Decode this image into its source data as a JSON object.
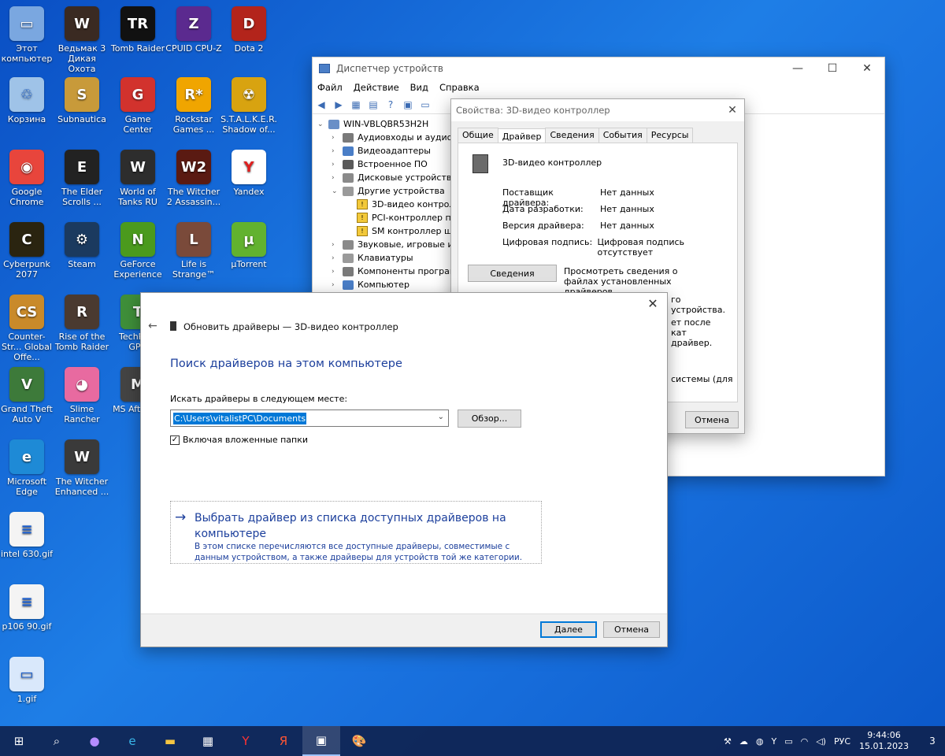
{
  "desktop": {
    "icons": [
      {
        "label": "Этот компьютер",
        "color": "#7aa7e0",
        "glyph": "▭"
      },
      {
        "label": "Ведьмак 3 Дикая Охота",
        "color": "#3a2a22",
        "glyph": "W"
      },
      {
        "label": "Tomb Raider",
        "color": "#111111",
        "glyph": "TR"
      },
      {
        "label": "CPUID CPU-Z",
        "color": "#5b2a8f",
        "glyph": "Z"
      },
      {
        "label": "Dota 2",
        "color": "#b3241b",
        "glyph": "D"
      },
      {
        "label": "Корзина",
        "color": "#9fc3e8",
        "glyph": "♲"
      },
      {
        "label": "Subnautica",
        "color": "#c89a3a",
        "glyph": "S"
      },
      {
        "label": "Game Center",
        "color": "#d2322d",
        "glyph": "G"
      },
      {
        "label": "Rockstar Games ...",
        "color": "#f0a500",
        "glyph": "R*"
      },
      {
        "label": "S.T.A.L.K.E.R. Shadow of...",
        "color": "#d8a310",
        "glyph": "☢"
      },
      {
        "label": "Google Chrome",
        "color": "#e8453c",
        "glyph": "◉"
      },
      {
        "label": "The Elder Scrolls ...",
        "color": "#222222",
        "glyph": "E"
      },
      {
        "label": "World of Tanks RU",
        "color": "#2d2d2d",
        "glyph": "W"
      },
      {
        "label": "The Witcher 2 Assassin...",
        "color": "#5a1a12",
        "glyph": "W2"
      },
      {
        "label": "Yandex",
        "color": "#ffffff",
        "glyph": "Y"
      },
      {
        "label": "Cyberpunk 2077",
        "color": "#2a2410",
        "glyph": "C"
      },
      {
        "label": "Steam",
        "color": "#1b3a5f",
        "glyph": "⚙"
      },
      {
        "label": "GeForce Experience",
        "color": "#4b9a1d",
        "glyph": "N"
      },
      {
        "label": "Life is Strange™",
        "color": "#7a4a3a",
        "glyph": "L"
      },
      {
        "label": "µTorrent",
        "color": "#62b22f",
        "glyph": "µ"
      },
      {
        "label": "Counter-Str... Global Offe...",
        "color": "#c98a2a",
        "glyph": "CS"
      },
      {
        "label": "Rise of the Tomb Raider",
        "color": "#4a3a30",
        "glyph": "R"
      },
      {
        "label": "TechPo... GPU",
        "color": "#3f8f3a",
        "glyph": "T"
      },
      {
        "label": "Grand Theft Auto V",
        "color": "#3d7a3a",
        "glyph": "V"
      },
      {
        "label": "Slime Rancher",
        "color": "#e86aa0",
        "glyph": "◕"
      },
      {
        "label": "MS Afterb...",
        "color": "#444444",
        "glyph": "M"
      },
      {
        "label": "Microsoft Edge",
        "color": "#1e8ad6",
        "glyph": "e"
      },
      {
        "label": "The Witcher Enhanced ...",
        "color": "#3a3a3a",
        "glyph": "W"
      },
      {
        "label": "intel 630.gif",
        "color": "#f4f4f4",
        "glyph": "≡"
      },
      {
        "label": "p106 90.gif",
        "color": "#f4f4f4",
        "glyph": "≡"
      },
      {
        "label": "1.gif",
        "color": "#d9e8fb",
        "glyph": "▭"
      }
    ]
  },
  "device_manager": {
    "title": "Диспетчер устройств",
    "menu": [
      "Файл",
      "Действие",
      "Вид",
      "Справка"
    ],
    "root": "WIN-VBLQBR53H2H",
    "tree": [
      {
        "label": "Аудиовходы и аудиовы",
        "expanded": false,
        "warn": false,
        "indent": 1
      },
      {
        "label": "Видеоадаптеры",
        "expanded": false,
        "warn": false,
        "indent": 1
      },
      {
        "label": "Встроенное ПО",
        "expanded": false,
        "warn": false,
        "indent": 1
      },
      {
        "label": "Дисковые устройства",
        "expanded": false,
        "warn": false,
        "indent": 1
      },
      {
        "label": "Другие устройства",
        "expanded": true,
        "warn": false,
        "indent": 1
      },
      {
        "label": "3D-видео контролл",
        "expanded": false,
        "warn": true,
        "indent": 2
      },
      {
        "label": "PCI-контроллер пам",
        "expanded": false,
        "warn": true,
        "indent": 2
      },
      {
        "label": "SM контроллер ши",
        "expanded": false,
        "warn": true,
        "indent": 2
      },
      {
        "label": "Звуковые, игровые и в",
        "expanded": false,
        "warn": false,
        "indent": 1
      },
      {
        "label": "Клавиатуры",
        "expanded": false,
        "warn": false,
        "indent": 1
      },
      {
        "label": "Компоненты программ",
        "expanded": false,
        "warn": false,
        "indent": 1
      },
      {
        "label": "Компьютер",
        "expanded": false,
        "warn": false,
        "indent": 1
      }
    ]
  },
  "properties": {
    "title": "Свойства: 3D-видео контроллер",
    "tabs": [
      "Общие",
      "Драйвер",
      "Сведения",
      "События",
      "Ресурсы"
    ],
    "active_tab": "Драйвер",
    "device_name": "3D-видео контроллер",
    "rows": [
      {
        "key": "Поставщик драйвера:",
        "value": "Нет данных"
      },
      {
        "key": "Дата разработки:",
        "value": "Нет данных"
      },
      {
        "key": "Версия драйвера:",
        "value": "Нет данных"
      },
      {
        "key": "Цифровая подпись:",
        "value": "Цифровая подпись отсутствует"
      }
    ],
    "details_button": "Сведения",
    "details_text": "Просмотреть сведения о файлах установленных драйверов.",
    "partial_1": "го устройства.",
    "partial_2": "ет после\nкат\nдрайвер.",
    "partial_3": "системы (для",
    "cancel_button": "Отмена"
  },
  "wizard": {
    "title": "Обновить драйверы — 3D-видео контроллер",
    "heading": "Поиск драйверов на этом компьютере",
    "search_label": "Искать драйверы в следующем месте:",
    "path_value": "C:\\Users\\vitalistPC\\Documents",
    "browse_button": "Обзор...",
    "include_subfolders": "Включая вложенные папки",
    "include_subfolders_checked": true,
    "pick_title": "Выбрать драйвер из списка доступных драйверов на компьютере",
    "pick_desc": "В этом списке перечисляются все доступные драйверы, совместимые с данным устройством, а также драйверы для устройств той же категории.",
    "next_button": "Далее",
    "cancel_button": "Отмена"
  },
  "taskbar": {
    "language": "РУС",
    "time": "9:44:06",
    "date": "15.01.2023",
    "notifications": "3"
  }
}
